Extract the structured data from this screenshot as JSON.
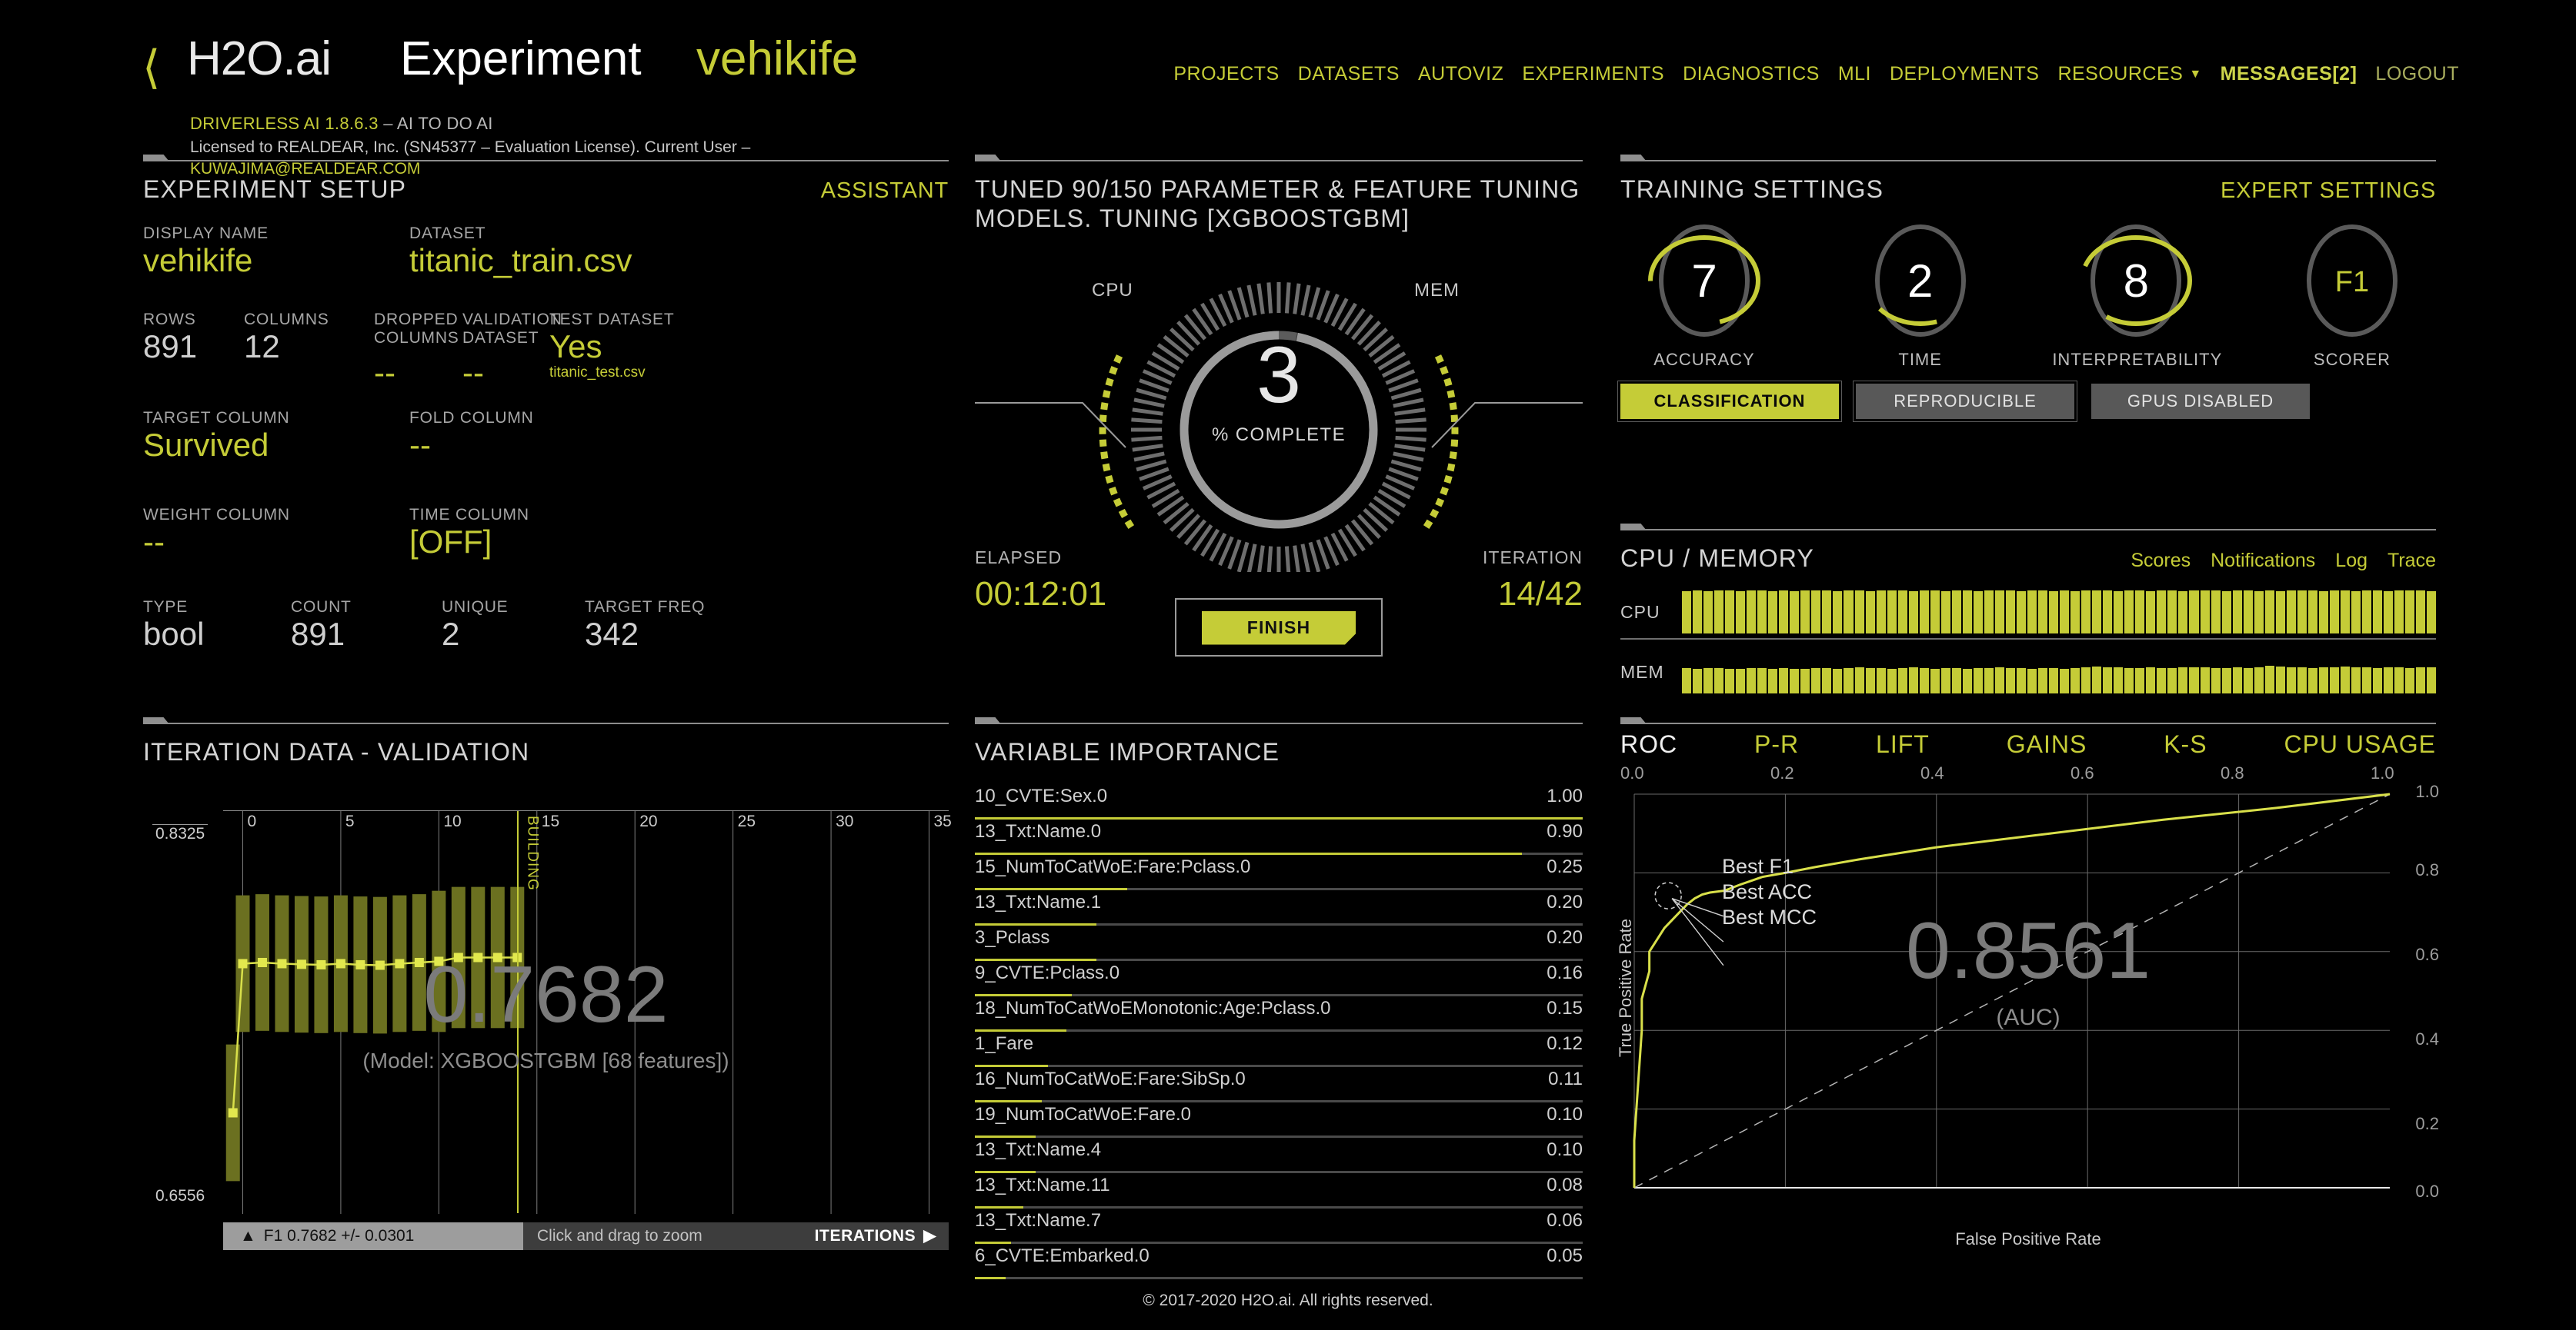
{
  "header": {
    "back_icon": "chevron-left-icon",
    "brand": "H2O.ai",
    "experiment_word": "Experiment",
    "experiment_name": "vehikife",
    "version_main": "DRIVERLESS AI 1.8.6.3",
    "version_tag": "– AI TO DO AI",
    "license": "Licensed to REALDEAR, Inc. (SN45377 – Evaluation License). Current User –",
    "license_email": "KUWAJIMA@REALDEAR.COM",
    "nav": [
      {
        "label": "PROJECTS",
        "style": "normal"
      },
      {
        "label": "DATASETS",
        "style": "normal"
      },
      {
        "label": "AUTOVIZ",
        "style": "normal"
      },
      {
        "label": "EXPERIMENTS",
        "style": "normal"
      },
      {
        "label": "DIAGNOSTICS",
        "style": "normal"
      },
      {
        "label": "MLI",
        "style": "normal"
      },
      {
        "label": "DEPLOYMENTS",
        "style": "normal"
      },
      {
        "label": "RESOURCES",
        "style": "dropdown"
      },
      {
        "label": "MESSAGES[2]",
        "style": "strong"
      },
      {
        "label": "LOGOUT",
        "style": "muted"
      }
    ]
  },
  "setup": {
    "title": "EXPERIMENT SETUP",
    "assistant_link": "ASSISTANT",
    "display_name_label": "DISPLAY NAME",
    "display_name_value": "vehikife",
    "dataset_label": "DATASET",
    "dataset_value": "titanic_train.csv",
    "rows_label": "ROWS",
    "rows_value": "891",
    "columns_label": "COLUMNS",
    "columns_value": "12",
    "dropped_label": "DROPPED COLUMNS",
    "dropped_value": "--",
    "validation_label": "VALIDATION DATASET",
    "validation_value": "--",
    "test_label": "TEST DATASET",
    "test_value": "Yes",
    "test_sub": "titanic_test.csv",
    "target_label": "TARGET COLUMN",
    "target_value": "Survived",
    "fold_label": "FOLD COLUMN",
    "fold_value": "--",
    "weight_label": "WEIGHT COLUMN",
    "weight_value": "--",
    "time_label": "TIME COLUMN",
    "time_value": "[OFF]",
    "type_label": "TYPE",
    "type_value": "bool",
    "count_label": "COUNT",
    "count_value": "891",
    "unique_label": "UNIQUE",
    "unique_value": "2",
    "targetfreq_label": "TARGET FREQ",
    "targetfreq_value": "342"
  },
  "tuning": {
    "title_line1": "TUNED 90/150 PARAMETER & FEATURE TUNING",
    "title_line2": "MODELS. TUNING [XGBOOSTGBM]",
    "cpu_label": "CPU",
    "mem_label": "MEM",
    "percent": "3",
    "percent_sub": "% COMPLETE",
    "elapsed_label": "ELAPSED",
    "elapsed_value": "00:12:01",
    "iteration_label": "ITERATION",
    "iteration_value": "14/42",
    "finish_label": "FINISH"
  },
  "training": {
    "title": "TRAINING SETTINGS",
    "expert_link": "EXPERT SETTINGS",
    "dials": [
      {
        "value": "7",
        "caption": "ACCURACY",
        "pct": 70,
        "accent": false
      },
      {
        "value": "2",
        "caption": "TIME",
        "pct": 20,
        "accent": false
      },
      {
        "value": "8",
        "caption": "INTERPRETABILITY",
        "pct": 80,
        "accent": false
      },
      {
        "value": "F1",
        "caption": "SCORER",
        "pct": 0,
        "accent": true
      }
    ],
    "pills": [
      {
        "label": "CLASSIFICATION",
        "state": "on"
      },
      {
        "label": "REPRODUCIBLE",
        "state": "off"
      },
      {
        "label": "GPUS DISABLED",
        "state": "plain"
      }
    ]
  },
  "cpumem": {
    "title": "CPU / MEMORY",
    "links": [
      "Scores",
      "Notifications",
      "Log",
      "Trace"
    ],
    "cpu_label": "CPU",
    "mem_label": "MEM"
  },
  "iteration": {
    "title": "ITERATION DATA - VALIDATION",
    "y_top": "0.8325",
    "y_bottom": "0.6556",
    "x_ticks": [
      "0",
      "5",
      "10",
      "15",
      "20",
      "25",
      "30",
      "35"
    ],
    "building_label": "BUILDING",
    "score": "0.7682",
    "model_sub": "(Model: XGBOOSTGBM [68 features])",
    "legend": "F1 0.7682 +/- 0.0301",
    "zoom_hint": "Click and drag to zoom",
    "axis_name": "ITERATIONS"
  },
  "varimp": {
    "title": "VARIABLE IMPORTANCE",
    "rows": [
      {
        "name": "10_CVTE:Sex.0",
        "value": "1.00"
      },
      {
        "name": "13_Txt:Name.0",
        "value": "0.90"
      },
      {
        "name": "15_NumToCatWoE:Fare:Pclass.0",
        "value": "0.25"
      },
      {
        "name": "13_Txt:Name.1",
        "value": "0.20"
      },
      {
        "name": "3_Pclass",
        "value": "0.20"
      },
      {
        "name": "9_CVTE:Pclass.0",
        "value": "0.16"
      },
      {
        "name": "18_NumToCatWoEMonotonic:Age:Pclass.0",
        "value": "0.15"
      },
      {
        "name": "1_Fare",
        "value": "0.12"
      },
      {
        "name": "16_NumToCatWoE:Fare:SibSp.0",
        "value": "0.11"
      },
      {
        "name": "19_NumToCatWoE:Fare.0",
        "value": "0.10"
      },
      {
        "name": "13_Txt:Name.4",
        "value": "0.10"
      },
      {
        "name": "13_Txt:Name.11",
        "value": "0.08"
      },
      {
        "name": "13_Txt:Name.7",
        "value": "0.06"
      },
      {
        "name": "6_CVTE:Embarked.0",
        "value": "0.05"
      }
    ]
  },
  "roc": {
    "tabs": [
      {
        "label": "ROC",
        "active": true
      },
      {
        "label": "P-R",
        "active": false
      },
      {
        "label": "LIFT",
        "active": false
      },
      {
        "label": "GAINS",
        "active": false
      },
      {
        "label": "K-S",
        "active": false
      },
      {
        "label": "CPU USAGE",
        "active": false
      }
    ],
    "x_ticks": [
      "0.0",
      "0.2",
      "0.4",
      "0.6",
      "0.8",
      "1.0"
    ],
    "y_ticks": [
      "1.0",
      "0.8",
      "0.6",
      "0.4",
      "0.2",
      "0.0"
    ],
    "y_axis_label": "True Positive Rate",
    "x_axis_label": "False Positive Rate",
    "auc": "0.8561",
    "auc_sub": "(AUC)",
    "annotations": [
      "Best F1",
      "Best ACC",
      "Best MCC"
    ]
  },
  "footer": {
    "text": "© 2017-2020 H2O.ai. All rights reserved."
  },
  "colors": {
    "accent": "#c5cc37",
    "background": "#000000",
    "text": "#d8d8d8"
  },
  "chart_data": [
    {
      "type": "line",
      "title": "ITERATION DATA - VALIDATION",
      "xlabel": "ITERATIONS",
      "ylabel": "F1",
      "ylim": [
        0.6556,
        0.8325
      ],
      "xlim": [
        -1,
        36
      ],
      "x": [
        -0.5,
        0,
        1,
        2,
        3,
        4,
        5,
        6,
        7,
        8,
        9,
        10,
        11,
        12,
        13,
        14
      ],
      "values": [
        0.7,
        0.7655,
        0.766,
        0.7655,
        0.7652,
        0.765,
        0.7655,
        0.765,
        0.7648,
        0.7655,
        0.766,
        0.7665,
        0.7682,
        0.7682,
        0.7682,
        0.7682
      ],
      "error_bars": [
        0.03,
        0.03,
        0.03,
        0.03,
        0.03,
        0.03,
        0.03,
        0.03,
        0.03,
        0.03,
        0.03,
        0.031,
        0.031,
        0.031,
        0.031,
        0.031
      ],
      "annotation": "BUILDING",
      "annotation_x": 14,
      "legend": "F1 0.7682 +/- 0.0301",
      "grid": true
    },
    {
      "type": "bar",
      "title": "VARIABLE IMPORTANCE",
      "categories": [
        "10_CVTE:Sex.0",
        "13_Txt:Name.0",
        "15_NumToCatWoE:Fare:Pclass.0",
        "13_Txt:Name.1",
        "3_Pclass",
        "9_CVTE:Pclass.0",
        "18_NumToCatWoEMonotonic:Age:Pclass.0",
        "1_Fare",
        "16_NumToCatWoE:Fare:SibSp.0",
        "19_NumToCatWoE:Fare.0",
        "13_Txt:Name.4",
        "13_Txt:Name.11",
        "13_Txt:Name.7",
        "6_CVTE:Embarked.0"
      ],
      "values": [
        1.0,
        0.9,
        0.25,
        0.2,
        0.2,
        0.16,
        0.15,
        0.12,
        0.11,
        0.1,
        0.1,
        0.08,
        0.06,
        0.05
      ],
      "xlabel": "",
      "ylabel": "",
      "ylim": [
        0,
        1.0
      ],
      "grid": false
    },
    {
      "type": "line",
      "title": "ROC",
      "xlabel": "False Positive Rate",
      "ylabel": "True Positive Rate",
      "xlim": [
        0,
        1
      ],
      "ylim": [
        0,
        1
      ],
      "auc": 0.8561,
      "x": [
        0.0,
        0.0,
        0.01,
        0.01,
        0.02,
        0.02,
        0.03,
        0.04,
        0.05,
        0.06,
        0.07,
        0.08,
        0.09,
        0.1,
        0.12,
        0.14,
        0.17,
        0.2,
        0.24,
        0.3,
        0.4,
        0.55,
        0.7,
        0.85,
        1.0
      ],
      "y": [
        0.0,
        0.12,
        0.4,
        0.48,
        0.55,
        0.6,
        0.63,
        0.66,
        0.68,
        0.7,
        0.72,
        0.735,
        0.745,
        0.75,
        0.755,
        0.77,
        0.79,
        0.8,
        0.815,
        0.835,
        0.865,
        0.9,
        0.935,
        0.965,
        1.0
      ],
      "reference_line": {
        "type": "diagonal",
        "style": "dashed"
      },
      "grid": true
    },
    {
      "type": "area",
      "title": "CPU / MEMORY",
      "series": [
        {
          "name": "CPU",
          "values": [
            98,
            100,
            97,
            99,
            100,
            98,
            100,
            99,
            97,
            100,
            98,
            100,
            99,
            100,
            97,
            99,
            100,
            98,
            100,
            99,
            100,
            98,
            99,
            100,
            97,
            100,
            99,
            98,
            100,
            99,
            100,
            98,
            100,
            99,
            97,
            100,
            98,
            100,
            99,
            100,
            98,
            99,
            100,
            97,
            100,
            99,
            98,
            100,
            99,
            100,
            98,
            100,
            99,
            97,
            100,
            98,
            100,
            99,
            100,
            98,
            99,
            100,
            97,
            100,
            99,
            98,
            100,
            99,
            100,
            98
          ]
        },
        {
          "name": "MEM",
          "values": [
            58,
            57,
            59,
            58,
            57,
            56,
            58,
            59,
            57,
            58,
            56,
            57,
            58,
            59,
            57,
            58,
            60,
            59,
            58,
            57,
            59,
            60,
            58,
            57,
            59,
            58,
            57,
            59,
            58,
            60,
            59,
            58,
            57,
            59,
            58,
            57,
            58,
            60,
            62,
            61,
            60,
            59,
            58,
            60,
            59,
            58,
            60,
            61,
            60,
            59,
            58,
            60,
            59,
            61,
            63,
            62,
            61,
            60,
            59,
            61,
            60,
            62,
            61,
            60,
            59,
            61,
            60,
            59,
            61,
            60
          ]
        }
      ],
      "ylim": [
        0,
        100
      ],
      "grid": false
    },
    {
      "type": "pie",
      "title": "% COMPLETE",
      "categories": [
        "complete",
        "remaining"
      ],
      "values": [
        3,
        97
      ],
      "grid": false
    }
  ]
}
